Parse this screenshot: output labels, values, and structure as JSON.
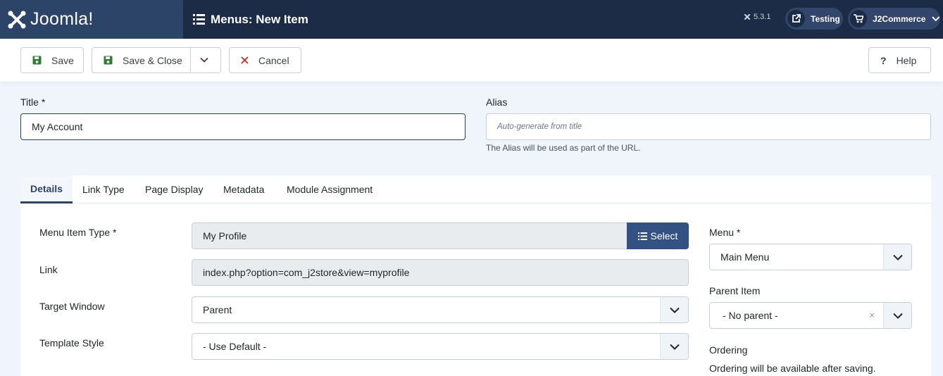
{
  "header": {
    "logo_text": "Joomla!",
    "page_title": "Menus: New Item",
    "version": "5.3.1",
    "testing_label": "Testing",
    "j2commerce_label": "J2Commerce"
  },
  "toolbar": {
    "save_label": "Save",
    "save_close_label": "Save & Close",
    "cancel_label": "Cancel",
    "help_label": "Help"
  },
  "form": {
    "title_label": "Title *",
    "title_value": "My Account",
    "alias_label": "Alias",
    "alias_placeholder": "Auto-generate from title",
    "alias_hint": "The Alias will be used as part of the URL."
  },
  "tabs": [
    {
      "label": "Details",
      "active": true
    },
    {
      "label": "Link Type"
    },
    {
      "label": "Page Display"
    },
    {
      "label": "Metadata"
    },
    {
      "label": "Module Assignment"
    }
  ],
  "details": {
    "menu_item_type_label": "Menu Item Type *",
    "menu_item_type_value": "My Profile",
    "select_label": "Select",
    "link_label": "Link",
    "link_value": "index.php?option=com_j2store&view=myprofile",
    "target_window_label": "Target Window",
    "target_window_value": "Parent",
    "template_style_label": "Template Style",
    "template_style_value": "- Use Default -"
  },
  "sidebar": {
    "menu_label": "Menu *",
    "menu_value": "Main Menu",
    "parent_item_label": "Parent Item",
    "parent_item_value": "- No parent -",
    "clear_symbol": "×",
    "ordering_label": "Ordering",
    "ordering_note": "Ordering will be available after saving."
  },
  "colors": {
    "header_bg": "#1c2b46",
    "logo_bg": "#2d4469",
    "primary": "#335183",
    "save_icon": "#2f7d32",
    "cancel_icon": "#c52827"
  }
}
